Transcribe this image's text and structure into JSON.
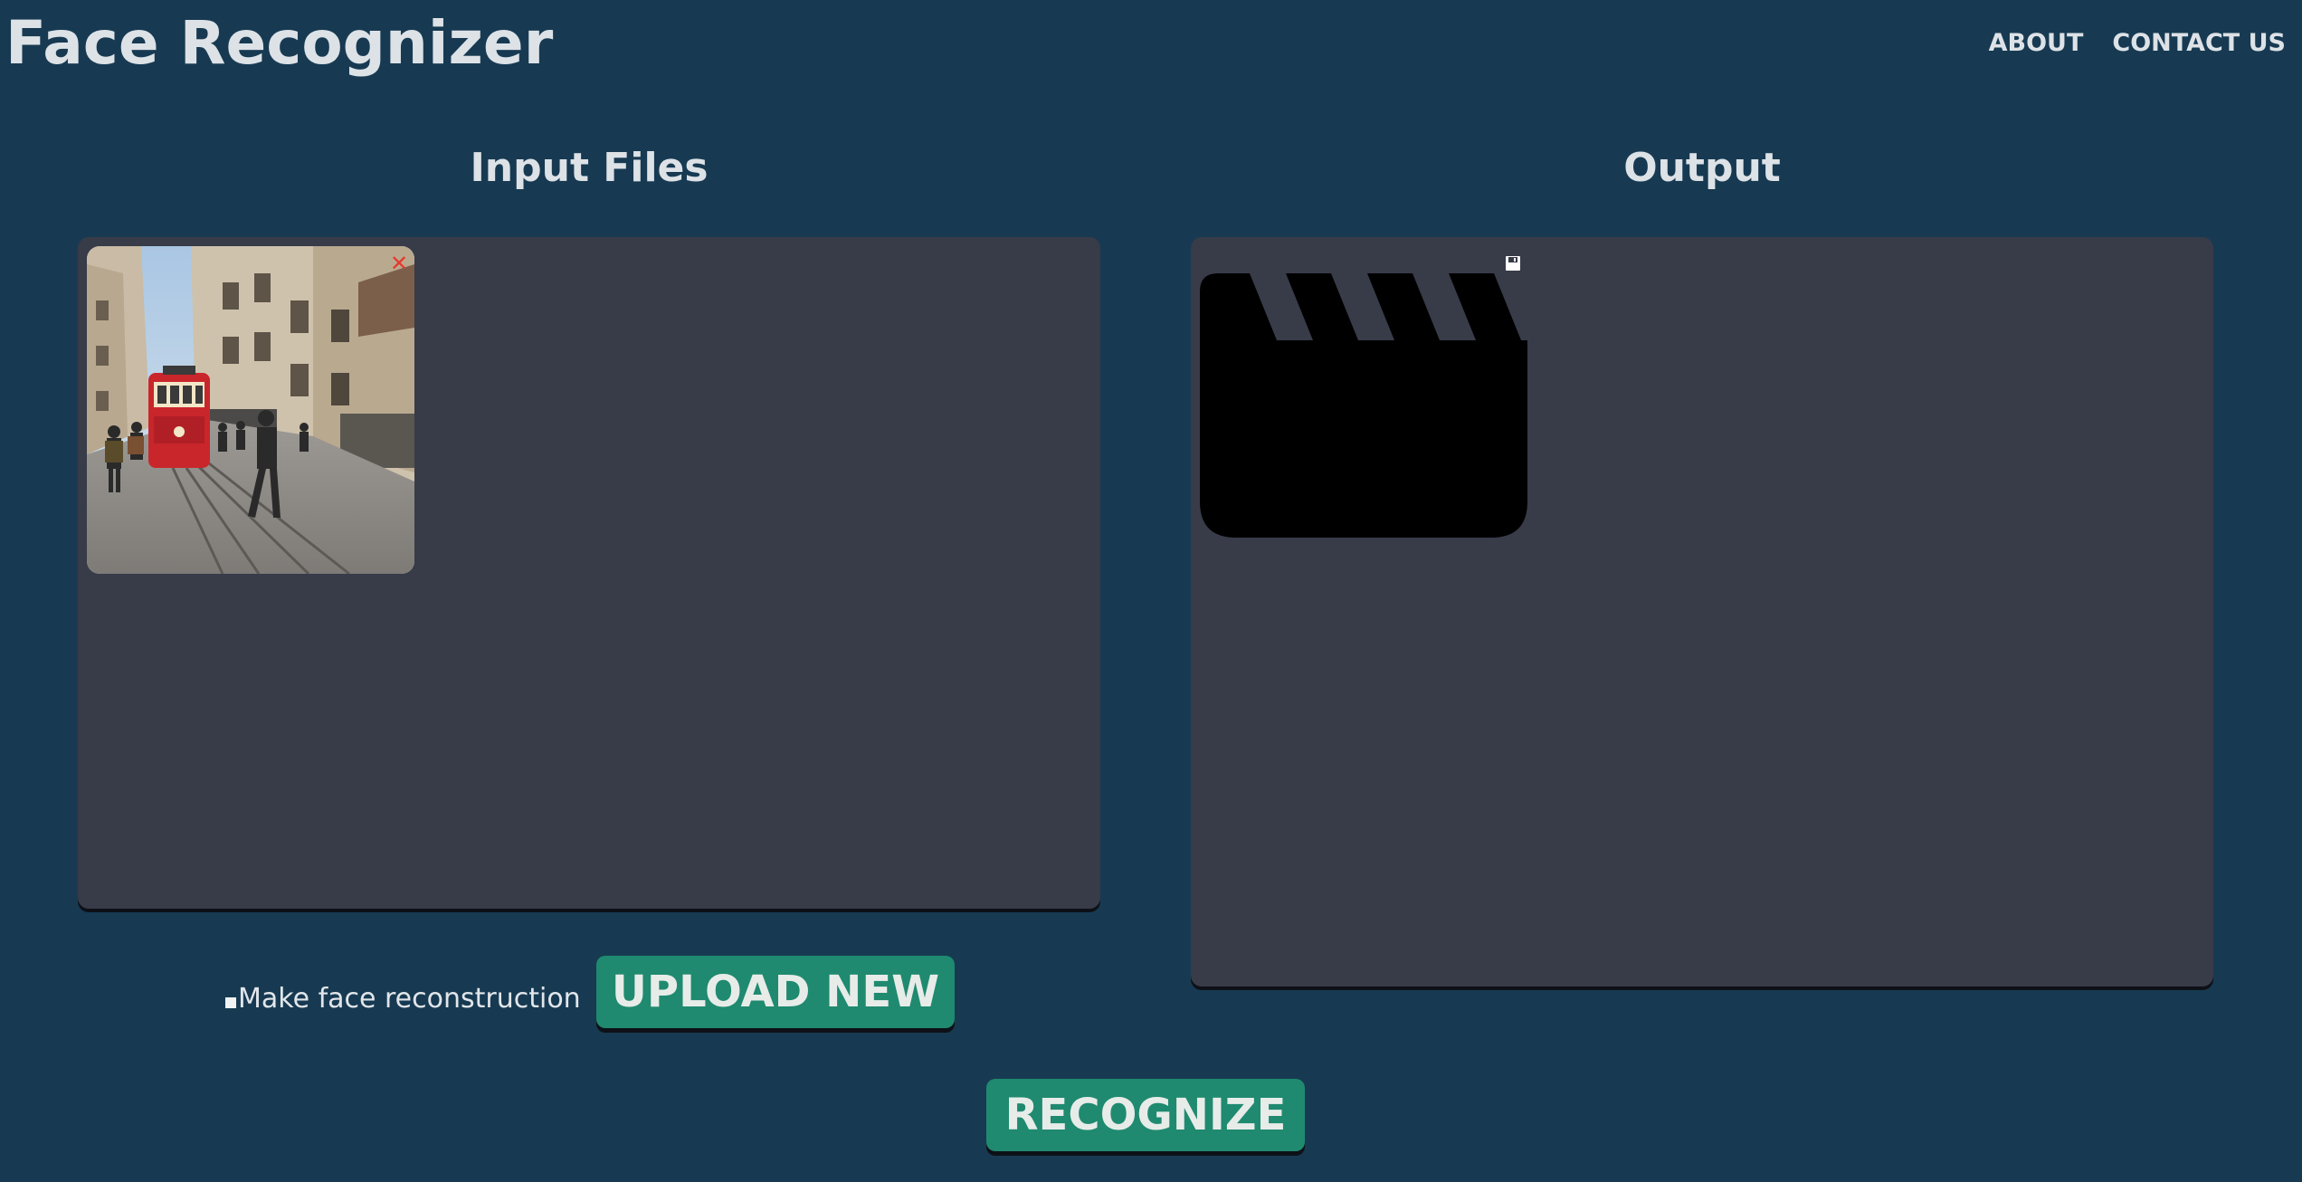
{
  "header": {
    "title": "Face Recognizer",
    "nav": [
      {
        "label": "ABOUT"
      },
      {
        "label": "CONTACT US"
      }
    ]
  },
  "input_panel": {
    "heading": "Input Files",
    "files": [
      {
        "name": "street-scene-image",
        "remove_icon": "close-icon",
        "remove_glyph": "✕"
      }
    ]
  },
  "output_panel": {
    "heading": "Output",
    "items": [
      {
        "type": "video",
        "icon": "clapperboard-icon",
        "save_icon": "save-icon"
      }
    ]
  },
  "options": {
    "face_reconstruction_label": "Make face reconstruction",
    "face_reconstruction_checked": false
  },
  "actions": {
    "upload_label": "UPLOAD NEW",
    "recognize_label": "RECOGNIZE"
  },
  "colors": {
    "background": "#173a52",
    "panel": "#383b48",
    "button": "#1f8a6f",
    "remove": "#e53a2c"
  }
}
